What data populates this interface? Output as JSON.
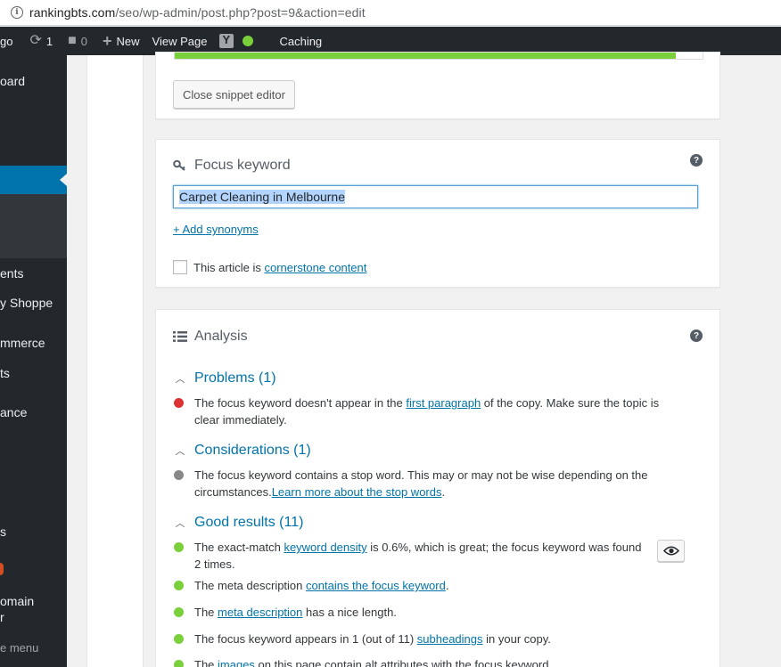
{
  "browser": {
    "url_host": "rankingbts.com",
    "url_path": "/seo/wp-admin/post.php?post=9&action=edit"
  },
  "adminbar": {
    "site_partial": "go",
    "updates_count": "1",
    "comments_count": "0",
    "new_label": "New",
    "view_page_label": "View Page",
    "caching_label": "Caching"
  },
  "sidebar": {
    "items": [
      {
        "label": "oard"
      },
      {
        "label": "ents"
      },
      {
        "label": "y Shoppe"
      },
      {
        "label": "mmerce"
      },
      {
        "label": "ts"
      },
      {
        "label": "ance"
      },
      {
        "label": "s"
      },
      {
        "label": "omain"
      },
      {
        "label": "r"
      },
      {
        "label": "e menu"
      }
    ]
  },
  "snippet": {
    "progress_percent": 95,
    "close_button": "Close snippet editor"
  },
  "focus_keyword": {
    "title": "Focus keyword",
    "value": "Carpet Cleaning in Melbourne",
    "add_synonyms": "+ Add synonyms",
    "cornerstone_prefix": "This article is ",
    "cornerstone_link": "cornerstone content"
  },
  "analysis": {
    "title": "Analysis",
    "problems": {
      "heading": "Problems (1)",
      "items": [
        {
          "pre": "The focus keyword doesn't appear in the ",
          "link": "first paragraph",
          "post": " of the copy. Make sure the topic is clear immediately."
        }
      ]
    },
    "considerations": {
      "heading": "Considerations (1)",
      "items": [
        {
          "pre": "The focus keyword contains a stop word. This may or may not be wise depending on the circumstances.",
          "link": "Learn more about the stop words",
          "post": "."
        }
      ]
    },
    "good": {
      "heading": "Good results (11)",
      "items": [
        {
          "pre": "The exact-match ",
          "link": "keyword density",
          "post": " is 0.6%, which is great; the focus keyword was found 2 times."
        },
        {
          "pre": "The meta description ",
          "link": "contains the focus keyword",
          "post": "."
        },
        {
          "pre": "The ",
          "link": "meta description",
          "post": " has a nice length."
        },
        {
          "pre": "The focus keyword appears in 1 (out of 11) ",
          "link": "subheadings",
          "post": " in your copy."
        },
        {
          "pre": "The ",
          "link": "images",
          "post": " on this page contain alt attributes with the focus keyword."
        }
      ]
    }
  },
  "colors": {
    "problem": "#dc3232",
    "consideration": "#888888",
    "good": "#7ad03a",
    "accent": "#0073aa"
  }
}
